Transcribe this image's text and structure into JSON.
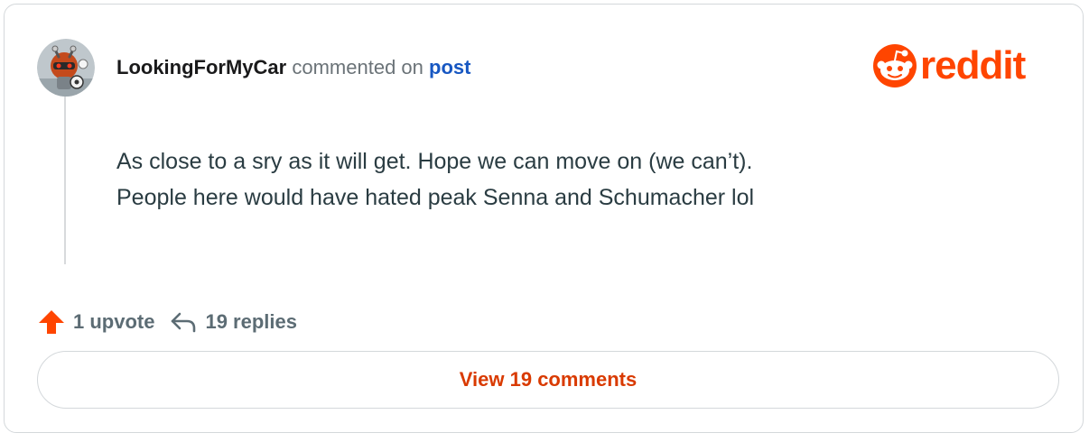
{
  "comment": {
    "username": "LookingForMyCar",
    "action_text": "commented on",
    "target_link": "post",
    "body_lines": [
      "As close to a sry as it will get. Hope we can move on (we can’t).",
      "People here would have hated peak Senna and Schumacher lol"
    ]
  },
  "branding": {
    "logo_text": "reddit",
    "logo_icon": "snoo-icon"
  },
  "stats": {
    "upvotes_label": "1 upvote",
    "upvote_icon": "upvote-arrow-icon",
    "replies_label": "19 replies",
    "reply_icon": "reply-arrow-icon"
  },
  "cta": {
    "view_comments_label": "View 19 comments"
  },
  "colors": {
    "brand": "#ff4500",
    "link": "#1757c2",
    "button_text": "#d93a00",
    "muted": "#5c6c74",
    "body_text": "#2a3c42"
  }
}
